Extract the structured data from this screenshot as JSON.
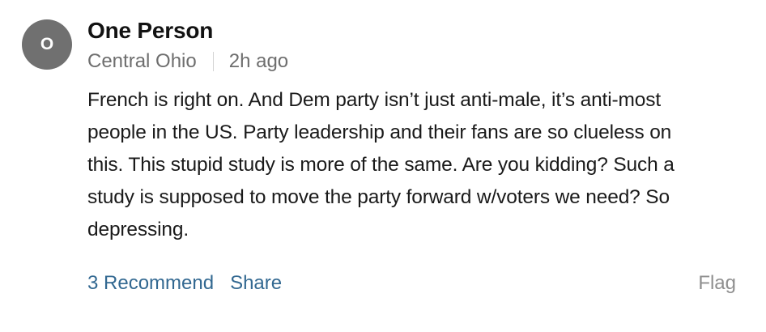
{
  "comment": {
    "avatar_initial": "O",
    "author": "One Person",
    "location": "Central Ohio",
    "timestamp": "2h ago",
    "body_lines": [
      "French is right on. And Dem party isn’t just anti-male, it’s anti-most",
      "people in the US. Party leadership and their fans are so clueless on",
      "this. This stupid study is more of the same. Are you kidding? Such a",
      "study is supposed to move the party forward w/voters we need? So",
      "depressing."
    ],
    "actions": {
      "recommend_label": "3 Recommend",
      "share_label": "Share",
      "flag_label": "Flag"
    }
  },
  "colors": {
    "avatar_bg": "#707070",
    "link": "#326891",
    "meta_text": "#6e6e6e",
    "flag_text": "#8f8f8f"
  }
}
